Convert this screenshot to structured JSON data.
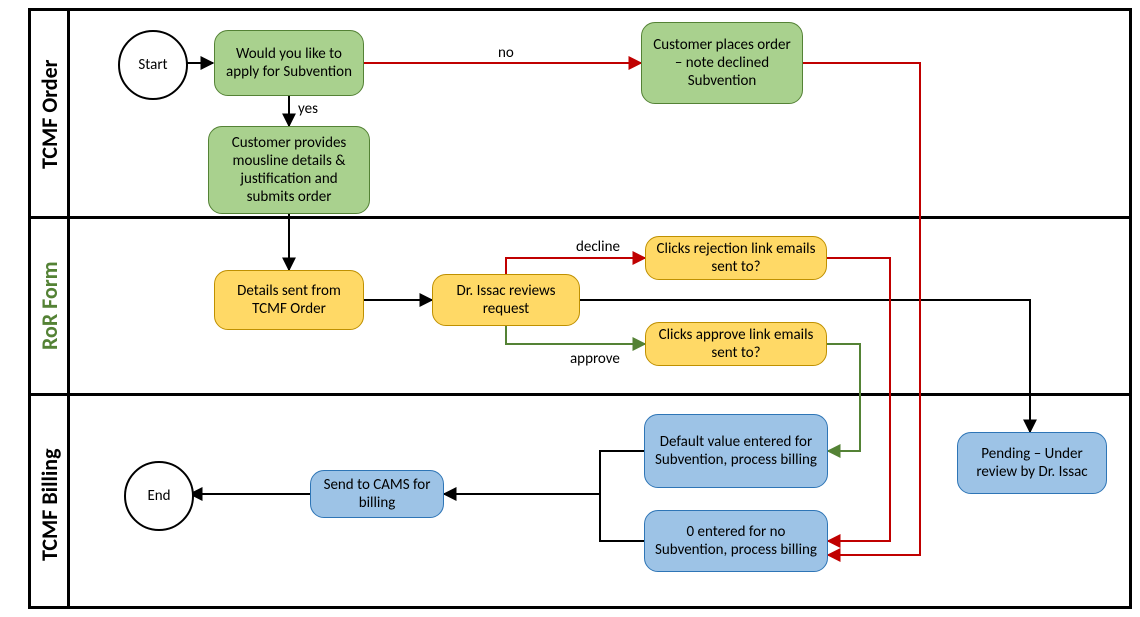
{
  "lanes": {
    "order": {
      "label": "TCMF Order",
      "color": "#000000"
    },
    "ror": {
      "label": "RoR Form",
      "color": "#548235"
    },
    "billing": {
      "label": "TCMF Billing",
      "color": "#000000"
    }
  },
  "nodes": {
    "start": {
      "text": "Start"
    },
    "apply": {
      "text": "Would you like to apply for Subvention"
    },
    "places_order": {
      "text": "Customer places order – note declined Subvention"
    },
    "provides_details": {
      "text": "Customer provides  mousline details & justification and submits order"
    },
    "details_sent": {
      "text": "Details sent from TCMF Order"
    },
    "reviews": {
      "text": "Dr. Issac reviews request"
    },
    "reject_link": {
      "text": "Clicks rejection link emails sent to?"
    },
    "approve_link": {
      "text": "Clicks approve link emails sent to?"
    },
    "default_value": {
      "text": "Default value entered for Subvention, process billing"
    },
    "zero_value": {
      "text": "0 entered for no Subvention, process  billing"
    },
    "send_cams": {
      "text": "Send to CAMS for billing"
    },
    "pending": {
      "text": "Pending – Under review by Dr. Issac"
    },
    "end": {
      "text": "End"
    }
  },
  "edge_labels": {
    "no": "no",
    "yes": "yes",
    "decline": "decline",
    "approve": "approve"
  },
  "colors": {
    "arrow_black": "#000000",
    "arrow_red": "#c00000",
    "arrow_green": "#548235"
  },
  "chart_data": {
    "type": "diagram",
    "subtype": "swimlane-flowchart",
    "lanes": [
      "TCMF Order",
      "RoR Form",
      "TCMF Billing"
    ],
    "nodes": [
      {
        "id": "start",
        "lane": "TCMF Order",
        "shape": "terminator",
        "label": "Start"
      },
      {
        "id": "apply",
        "lane": "TCMF Order",
        "shape": "process",
        "label": "Would you like to apply for Subvention"
      },
      {
        "id": "places_order",
        "lane": "TCMF Order",
        "shape": "process",
        "label": "Customer places order – note declined Subvention"
      },
      {
        "id": "provides_details",
        "lane": "TCMF Order",
        "shape": "process",
        "label": "Customer provides mousline details & justification and submits order"
      },
      {
        "id": "details_sent",
        "lane": "RoR Form",
        "shape": "process",
        "label": "Details sent from TCMF Order"
      },
      {
        "id": "reviews",
        "lane": "RoR Form",
        "shape": "process",
        "label": "Dr. Issac reviews request"
      },
      {
        "id": "reject_link",
        "lane": "RoR Form",
        "shape": "process",
        "label": "Clicks rejection link emails sent to?"
      },
      {
        "id": "approve_link",
        "lane": "RoR Form",
        "shape": "process",
        "label": "Clicks approve link emails sent to?"
      },
      {
        "id": "default_value",
        "lane": "TCMF Billing",
        "shape": "process",
        "label": "Default value entered for Subvention, process billing"
      },
      {
        "id": "zero_value",
        "lane": "TCMF Billing",
        "shape": "process",
        "label": "0 entered for no Subvention, process billing"
      },
      {
        "id": "send_cams",
        "lane": "TCMF Billing",
        "shape": "process",
        "label": "Send to CAMS for billing"
      },
      {
        "id": "pending",
        "lane": "TCMF Billing",
        "shape": "process",
        "label": "Pending – Under review by Dr. Issac"
      },
      {
        "id": "end",
        "lane": "TCMF Billing",
        "shape": "terminator",
        "label": "End"
      }
    ],
    "edges": [
      {
        "from": "start",
        "to": "apply",
        "label": "",
        "color": "black"
      },
      {
        "from": "apply",
        "to": "places_order",
        "label": "no",
        "color": "red"
      },
      {
        "from": "apply",
        "to": "provides_details",
        "label": "yes",
        "color": "black"
      },
      {
        "from": "provides_details",
        "to": "details_sent",
        "label": "",
        "color": "black"
      },
      {
        "from": "details_sent",
        "to": "reviews",
        "label": "",
        "color": "black"
      },
      {
        "from": "reviews",
        "to": "reject_link",
        "label": "decline",
        "color": "red"
      },
      {
        "from": "reviews",
        "to": "approve_link",
        "label": "approve",
        "color": "green"
      },
      {
        "from": "reviews",
        "to": "pending",
        "label": "",
        "color": "black"
      },
      {
        "from": "reject_link",
        "to": "zero_value",
        "label": "",
        "color": "red"
      },
      {
        "from": "approve_link",
        "to": "default_value",
        "label": "",
        "color": "green"
      },
      {
        "from": "places_order",
        "to": "zero_value",
        "label": "",
        "color": "red"
      },
      {
        "from": "default_value",
        "to": "send_cams",
        "label": "",
        "color": "black"
      },
      {
        "from": "zero_value",
        "to": "send_cams",
        "label": "",
        "color": "black"
      },
      {
        "from": "send_cams",
        "to": "end",
        "label": "",
        "color": "black"
      }
    ]
  }
}
